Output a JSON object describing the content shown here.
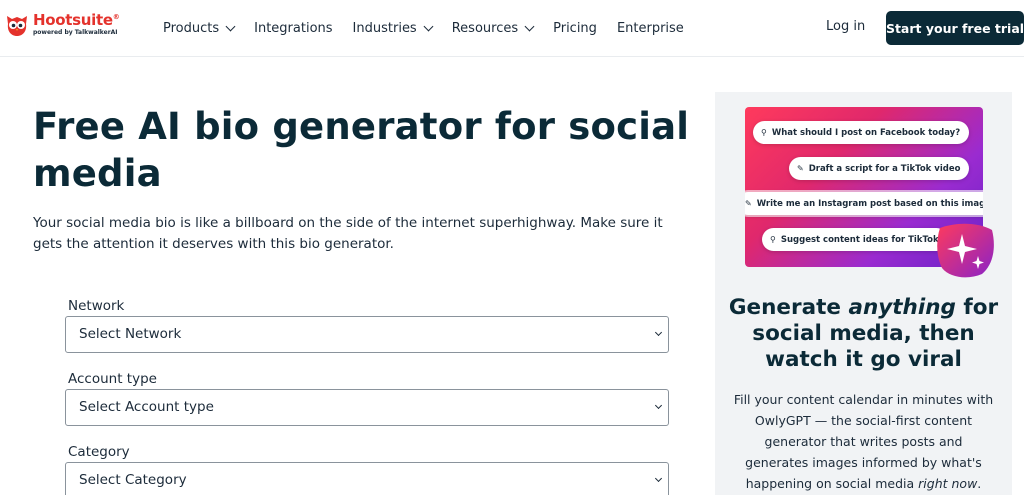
{
  "header": {
    "logo": {
      "name": "Hootsuite",
      "trademark": "®",
      "tagline": "powered by TalkwalkerAI"
    },
    "nav": [
      {
        "label": "Products",
        "dropdown": true
      },
      {
        "label": "Integrations",
        "dropdown": false
      },
      {
        "label": "Industries",
        "dropdown": true
      },
      {
        "label": "Resources",
        "dropdown": true
      },
      {
        "label": "Pricing",
        "dropdown": false
      },
      {
        "label": "Enterprise",
        "dropdown": false
      }
    ],
    "login_label": "Log in",
    "cta_label": "Start your free trial"
  },
  "main": {
    "title": "Free AI bio generator for social media",
    "description": "Your social media bio is like a billboard on the side of the internet superhighway. Make sure it gets the attention it deserves with this bio generator.",
    "form": {
      "network": {
        "label": "Network",
        "value": "Select Network"
      },
      "account_type": {
        "label": "Account type",
        "value": "Select Account type"
      },
      "category": {
        "label": "Category",
        "value": "Select Category"
      }
    }
  },
  "sidebar": {
    "promo_chips": [
      {
        "icon": "lightbulb-icon",
        "text": "What should I post on Facebook today?"
      },
      {
        "icon": "pencil-icon",
        "text": "Draft a script for a TikTok video"
      },
      {
        "icon": "pencil-icon",
        "text": "Write me an Instagram post based on this image"
      },
      {
        "icon": "lightbulb-icon",
        "text": "Suggest content ideas for TikTok"
      }
    ],
    "title_before": "Generate ",
    "title_emphasis": "anything",
    "title_after": " for social media, then watch it go viral",
    "desc_before": "Fill your content calendar in minutes with OwlyGPT — the social-first content generator that writes posts and generates images informed by what's happening on social media ",
    "desc_emphasis": "right now",
    "desc_after": "."
  },
  "colors": {
    "brand_red": "#e4322c",
    "navy": "#0b2a37",
    "panel_bg": "#f1f3f5",
    "gradient_start": "#ff3a5c",
    "gradient_end": "#6a22c8"
  }
}
